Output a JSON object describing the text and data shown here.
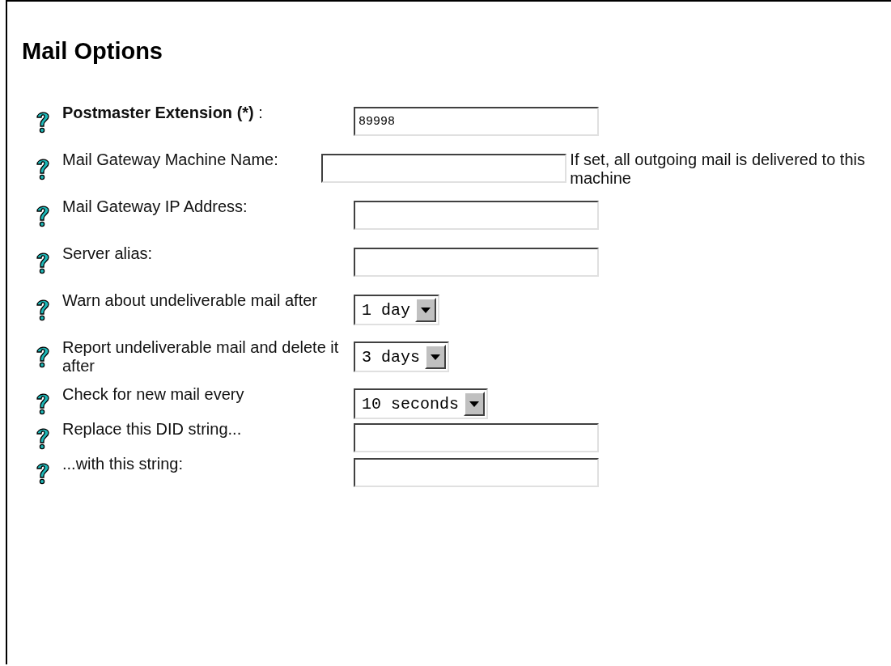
{
  "title": "Mail Options",
  "fields": [
    {
      "label": "**Postmaster Extension (*)** :",
      "kind": "text",
      "value": "89998"
    },
    {
      "label": "Mail Gateway Machine Name:",
      "kind": "text",
      "note": "If set, all outgoing mail is delivered to this machine"
    },
    {
      "label": "Mail Gateway IP Address:",
      "kind": "text"
    },
    {
      "label": "Server alias:",
      "kind": "text"
    },
    {
      "label": "Warn about undeliverable mail after",
      "kind": "select",
      "value": "1 day"
    },
    {
      "label": "Report undeliverable mail and delete it after",
      "kind": "select",
      "value": "3 days"
    },
    {
      "label": "Check for new mail every",
      "kind": "select",
      "value": "10 seconds"
    },
    {
      "label": "Replace this DID string...",
      "kind": "text"
    },
    {
      "label": "...with this string:",
      "kind": "text"
    }
  ]
}
